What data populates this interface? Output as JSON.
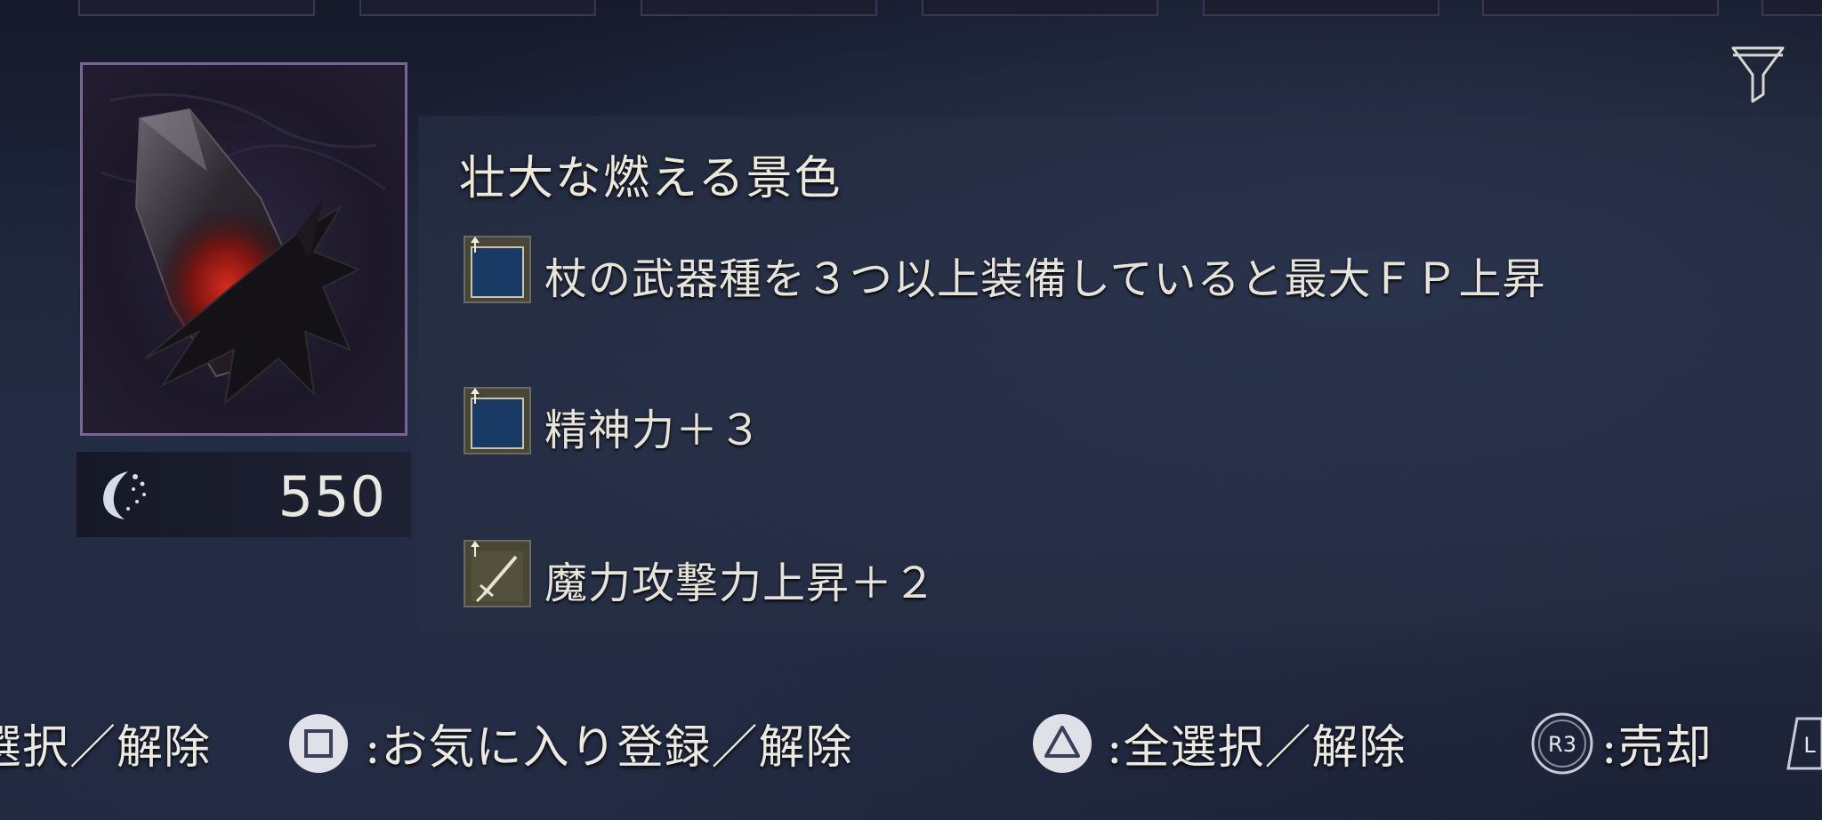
{
  "item": {
    "name": "壮大な燃える景色",
    "cost": "550",
    "effects": [
      {
        "icon": "stat-up-blue-icon",
        "text": "杖の武器種を３つ以上装備していると最大ＦＰ上昇"
      },
      {
        "icon": "stat-up-blue-icon",
        "text": "精神力＋３"
      },
      {
        "icon": "sword-attack-up-icon",
        "text": "魔力攻撃力上昇＋２"
      }
    ]
  },
  "controls": {
    "select_toggle": "選択／解除",
    "favorite_label": ":お気に入り登録／解除",
    "select_all_label": ":全選択／解除",
    "r3_glyph": "R3",
    "sell_label": ":売却",
    "l_glyph": "L"
  },
  "colors": {
    "frame_border": "#7a6494",
    "panel_bg": "#232b42",
    "text": "#e8e6e0"
  }
}
